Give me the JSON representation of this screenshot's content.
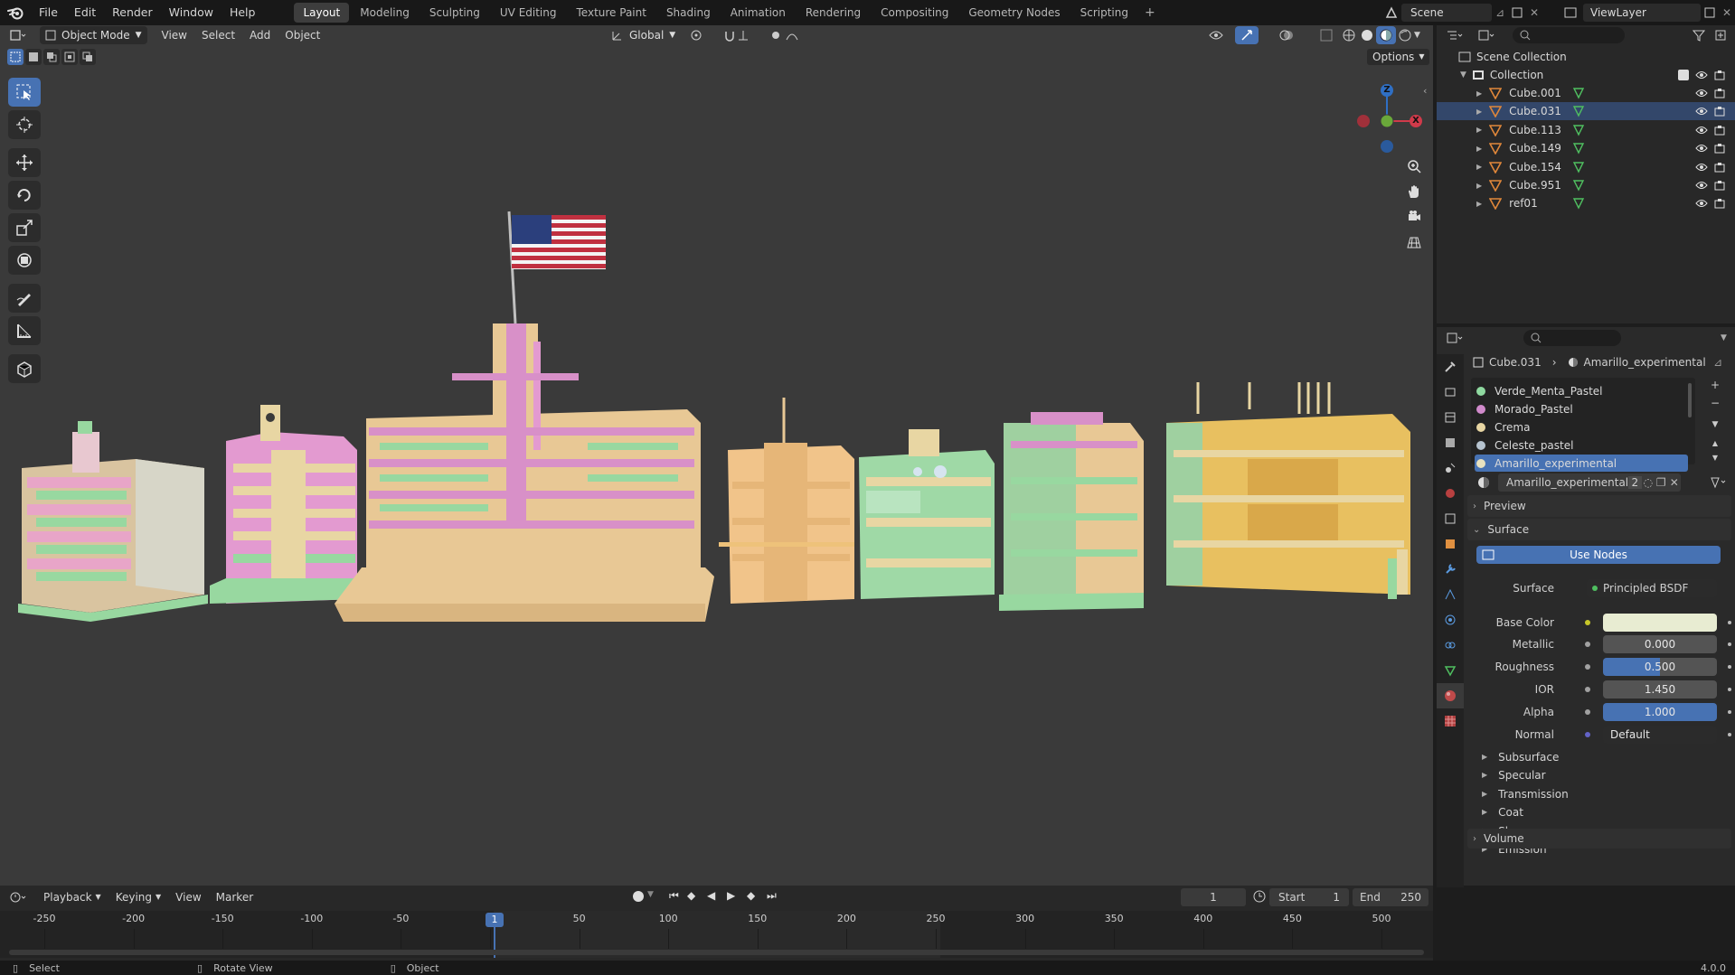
{
  "app": {
    "logo_icon": "blender-logo-icon"
  },
  "menu": [
    "File",
    "Edit",
    "Render",
    "Window",
    "Help"
  ],
  "workspaces": [
    {
      "label": "Layout",
      "active": true
    },
    {
      "label": "Modeling"
    },
    {
      "label": "Sculpting"
    },
    {
      "label": "UV Editing"
    },
    {
      "label": "Texture Paint"
    },
    {
      "label": "Shading"
    },
    {
      "label": "Animation"
    },
    {
      "label": "Rendering"
    },
    {
      "label": "Compositing"
    },
    {
      "label": "Geometry Nodes"
    },
    {
      "label": "Scripting"
    }
  ],
  "add_workspace": "+",
  "scene": {
    "name": "Scene",
    "view_layer": "ViewLayer"
  },
  "viewport": {
    "mode": "Object Mode",
    "menus": [
      "View",
      "Select",
      "Add",
      "Object"
    ],
    "transform_orientation": "Global",
    "options_label": "Options",
    "gizmo_axes": {
      "z": "Z",
      "y": "Y",
      "x": "X"
    },
    "background_color": "#3a3a3a"
  },
  "outliner": {
    "root": "Scene Collection",
    "collection": "Collection",
    "items": [
      {
        "name": "Cube.001",
        "selected": false
      },
      {
        "name": "Cube.031",
        "selected": true
      },
      {
        "name": "Cube.113",
        "selected": false
      },
      {
        "name": "Cube.149",
        "selected": false
      },
      {
        "name": "Cube.154",
        "selected": false
      },
      {
        "name": "Cube.951",
        "selected": false
      },
      {
        "name": "ref01",
        "selected": false
      }
    ]
  },
  "properties": {
    "breadcrumb_object": "Cube.031",
    "breadcrumb_material": "Amarillo_experimental",
    "materials": [
      {
        "name": "Verde_Menta_Pastel",
        "color": "#8fd9a0"
      },
      {
        "name": "Morado_Pastel",
        "color": "#d08acb"
      },
      {
        "name": "Crema",
        "color": "#e8d6a3"
      },
      {
        "name": "Celeste_pastel",
        "color": "#b6c3cf"
      },
      {
        "name": "Amarillo_experimental",
        "color": "#e8e2c0",
        "selected": true
      }
    ],
    "active_material": "Amarillo_experimental",
    "user_count": "2",
    "panels": {
      "preview": "Preview",
      "surface": "Surface",
      "volume": "Volume"
    },
    "use_nodes": "Use Nodes",
    "surface_label": "Surface",
    "surface_shader": "Principled BSDF",
    "fields": [
      {
        "label": "Base Color",
        "value": "",
        "swatch": "#e8ecd2"
      },
      {
        "label": "Metallic",
        "value": "0.000"
      },
      {
        "label": "Roughness",
        "value": "0.500",
        "fill": 0.5
      },
      {
        "label": "IOR",
        "value": "1.450"
      },
      {
        "label": "Alpha",
        "value": "1.000",
        "fill": 1.0
      },
      {
        "label": "Normal",
        "value": "Default"
      }
    ],
    "subpanels": [
      "Subsurface",
      "Specular",
      "Transmission",
      "Coat",
      "Sheen",
      "Emission"
    ]
  },
  "timeline": {
    "menus": [
      "Playback",
      "Keying",
      "View",
      "Marker"
    ],
    "current_frame": "1",
    "start_label": "Start",
    "start": "1",
    "end_label": "End",
    "end": "250",
    "ticks": [
      "-250",
      "-200",
      "-150",
      "-100",
      "-50",
      "0",
      "50",
      "100",
      "150",
      "200",
      "250",
      "300",
      "350",
      "400",
      "450",
      "500"
    ],
    "playhead": "1"
  },
  "statusbar": {
    "left": "Select",
    "middle": "Rotate View",
    "right": "Object",
    "version": "4.0.0"
  }
}
